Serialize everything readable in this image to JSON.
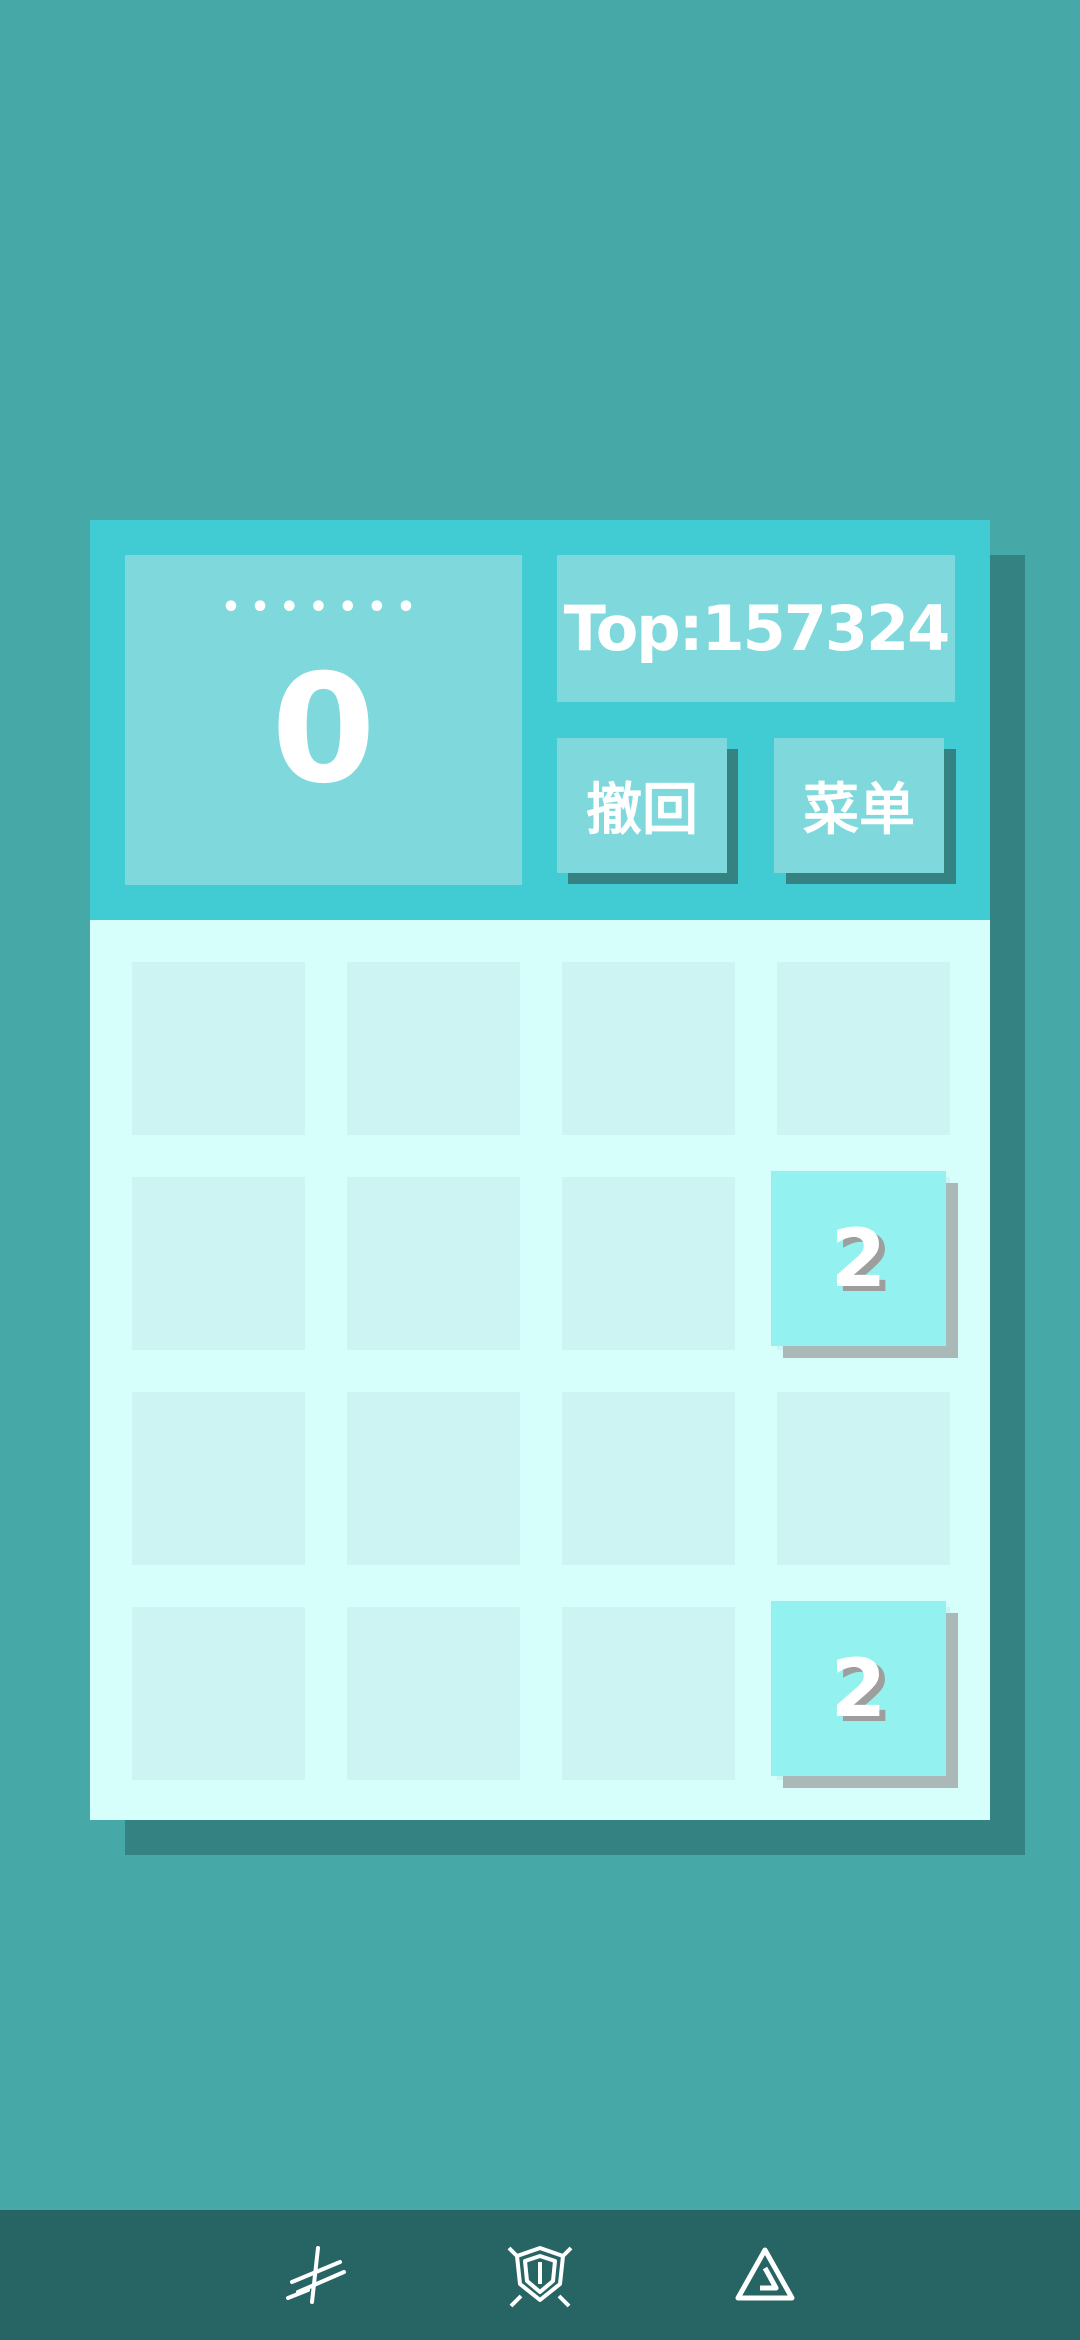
{
  "score_panel": {
    "dots": "•••••••",
    "score": "0"
  },
  "top_panel": {
    "label": "Top:157324"
  },
  "buttons": {
    "undo": "撤回",
    "menu": "菜单"
  },
  "grid": {
    "size": 4,
    "tiles": [
      {
        "row": 1,
        "col": 3,
        "value": "2"
      },
      {
        "row": 3,
        "col": 3,
        "value": "2"
      }
    ]
  },
  "navbar": {
    "icons": [
      "blade-icon",
      "shield-icon",
      "triangle-logo-icon"
    ]
  },
  "colors": {
    "background": "#47a8a8",
    "header": "#41cbd3",
    "panel": "#7fd9dc",
    "grid_bg": "#d6fffb",
    "empty_cell": "#cdf4f2",
    "tile": "#93f1f0",
    "navbar": "#276565"
  }
}
